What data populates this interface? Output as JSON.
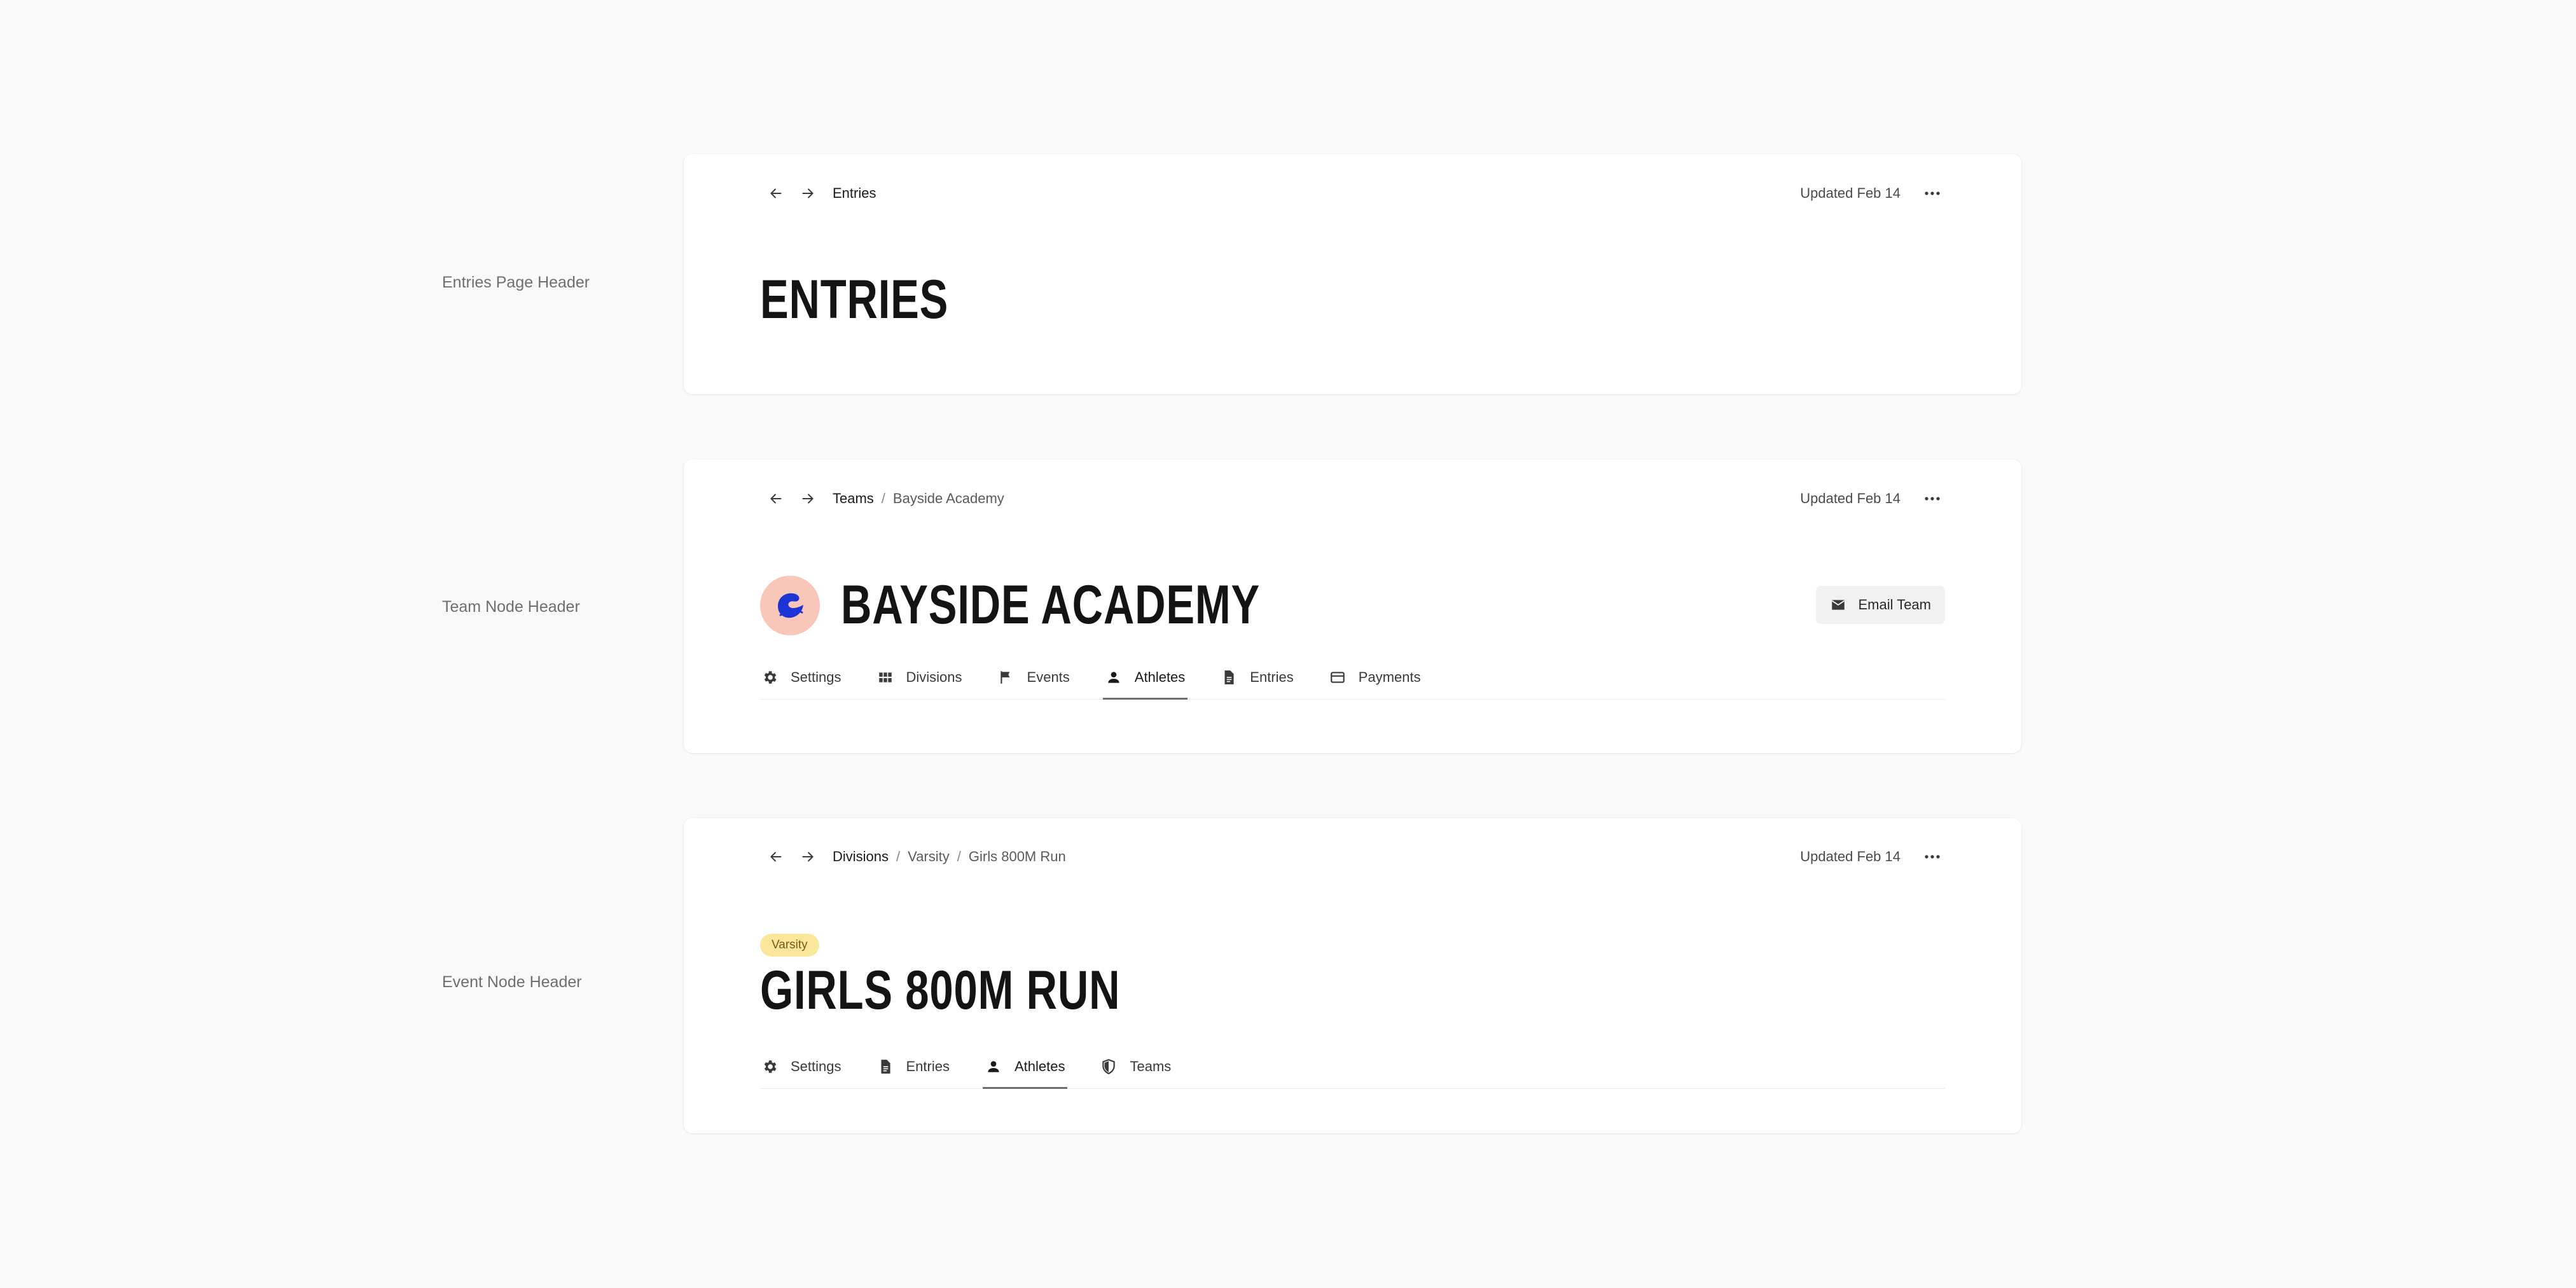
{
  "rows": [
    {
      "label": "Entries Page Header",
      "breadcrumb": {
        "root": "Entries",
        "items": []
      },
      "updated": "Updated Feb 14",
      "title": "ENTRIES"
    },
    {
      "label": "Team Node Header",
      "breadcrumb": {
        "root": "Teams",
        "items": [
          "Bayside Academy"
        ]
      },
      "updated": "Updated Feb 14",
      "title": "BAYSIDE ACADEMY",
      "logo_color": "#f9c7b9",
      "logo_mark_color": "#1c34d6",
      "action_button": {
        "label": "Email Team",
        "icon": "mail-icon"
      },
      "tabs": [
        {
          "label": "Settings",
          "icon": "gear-icon",
          "active": false
        },
        {
          "label": "Divisions",
          "icon": "grid-icon",
          "active": false
        },
        {
          "label": "Events",
          "icon": "flag-icon",
          "active": false
        },
        {
          "label": "Athletes",
          "icon": "person-icon",
          "active": true
        },
        {
          "label": "Entries",
          "icon": "document-icon",
          "active": false
        },
        {
          "label": "Payments",
          "icon": "credit-card-icon",
          "active": false
        }
      ]
    },
    {
      "label": "Event Node Header",
      "breadcrumb": {
        "root": "Divisions",
        "items": [
          "Varsity",
          "Girls 800M Run"
        ]
      },
      "updated": "Updated Feb 14",
      "badge": "Varsity",
      "badge_color": "#fbe79b",
      "title": "GIRLS 800M RUN",
      "tabs": [
        {
          "label": "Settings",
          "icon": "gear-icon",
          "active": false
        },
        {
          "label": "Entries",
          "icon": "document-icon",
          "active": false
        },
        {
          "label": "Athletes",
          "icon": "person-icon",
          "active": true
        },
        {
          "label": "Teams",
          "icon": "shield-icon",
          "active": false
        }
      ]
    }
  ]
}
